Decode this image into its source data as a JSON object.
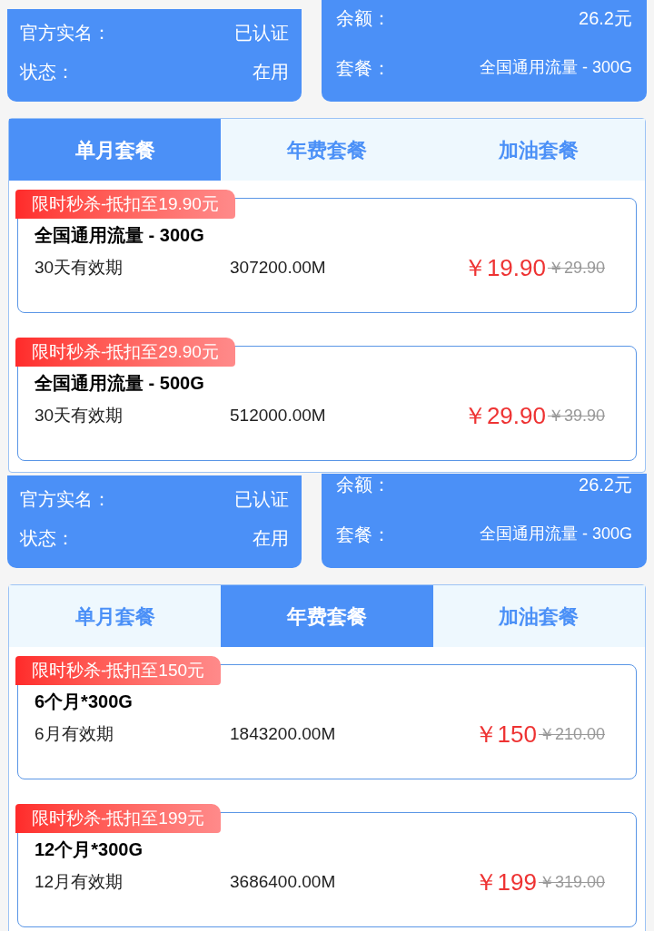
{
  "screens": [
    {
      "account": [
        {
          "label": "官方实名：",
          "value": "已认证"
        },
        {
          "label": "状态：",
          "value": "在用"
        }
      ],
      "balance": [
        {
          "label": "余额：",
          "value": "26.2元"
        },
        {
          "label": "套餐：",
          "value": "全国通用流量 - 300G"
        }
      ],
      "tabs": [
        {
          "label": "单月套餐",
          "selected": true
        },
        {
          "label": "年费套餐",
          "selected": false
        },
        {
          "label": "加油套餐",
          "selected": false
        }
      ],
      "plans": [
        {
          "badge": "限时秒杀-抵扣至19.90元",
          "title": "全国通用流量 - 300G",
          "validity": "30天有效期",
          "size": "307200.00M",
          "price": "￥19.90",
          "original_price": "￥29.90"
        },
        {
          "badge": "限时秒杀-抵扣至29.90元",
          "title": "全国通用流量 - 500G",
          "validity": "30天有效期",
          "size": "512000.00M",
          "price": "￥29.90",
          "original_price": "￥39.90"
        }
      ]
    },
    {
      "account": [
        {
          "label": "官方实名：",
          "value": "已认证"
        },
        {
          "label": "状态：",
          "value": "在用"
        }
      ],
      "balance": [
        {
          "label": "余额：",
          "value": "26.2元"
        },
        {
          "label": "套餐：",
          "value": "全国通用流量 - 300G"
        }
      ],
      "tabs": [
        {
          "label": "单月套餐",
          "selected": false
        },
        {
          "label": "年费套餐",
          "selected": true
        },
        {
          "label": "加油套餐",
          "selected": false
        }
      ],
      "plans": [
        {
          "badge": "限时秒杀-抵扣至150元",
          "title": "6个月*300G",
          "validity": "6月有效期",
          "size": "1843200.00M",
          "price": "￥150",
          "original_price": "￥210.00"
        },
        {
          "badge": "限时秒杀-抵扣至199元",
          "title": "12个月*300G",
          "validity": "12月有效期",
          "size": "3686400.00M",
          "price": "￥199",
          "original_price": "￥319.00"
        }
      ]
    }
  ]
}
